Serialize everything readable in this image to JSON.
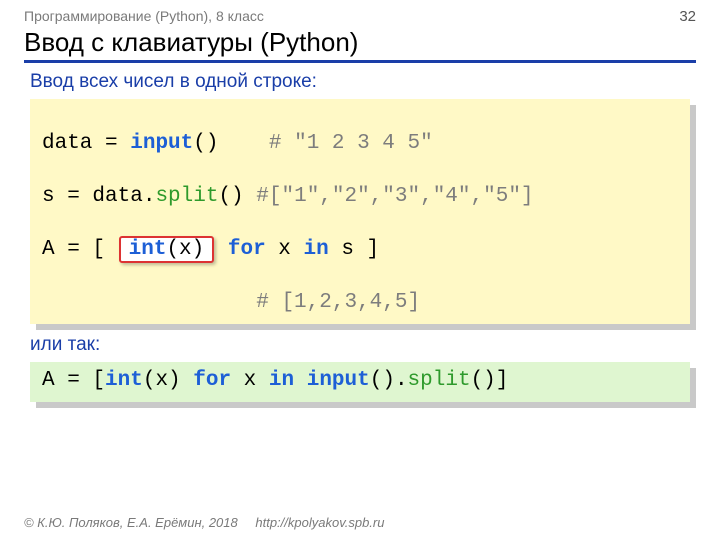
{
  "header": {
    "course": "Программирование (Python), 8 класс",
    "page": "32"
  },
  "title": "Ввод с клавиатуры (Python)",
  "sub1": "Ввод всех чисел в одной строке:",
  "code1": {
    "l1": {
      "a": "data",
      "eq": " = ",
      "inp": "input",
      "par": "()",
      "sp": "    ",
      "c": "# \"1 2 3 4 5\""
    },
    "l2": {
      "a": "s",
      "eq": " = ",
      "b": "data.",
      "m": "split",
      "par": "()",
      "sp": " ",
      "c": "#[\"1\",\"2\",\"3\",\"4\",\"5\"]"
    },
    "l3": {
      "a": "A",
      "eq": " = ",
      "lb": "[ ",
      "hi_int": "int",
      "hi_x": "(x)",
      "sp": " ",
      "for": "for",
      "mid": " x ",
      "in": "in",
      "tail": " s ]"
    },
    "l4": {
      "pad": "                 ",
      "c": "# [1,2,3,4,5]"
    }
  },
  "sub2": "или так:",
  "code2": {
    "a": "A",
    "eq": " = ",
    "lb": "[",
    "int": "int",
    "x": "(x) ",
    "for": "for",
    "mid": " x ",
    "in": "in",
    "sp": " ",
    "inp": "input",
    "par": "().",
    "split": "split",
    "tail": "()]"
  },
  "footer": {
    "copyright": "© К.Ю. Поляков, Е.А. Ерёмин, 2018",
    "link": "http://kpolyakov.spb.ru"
  }
}
